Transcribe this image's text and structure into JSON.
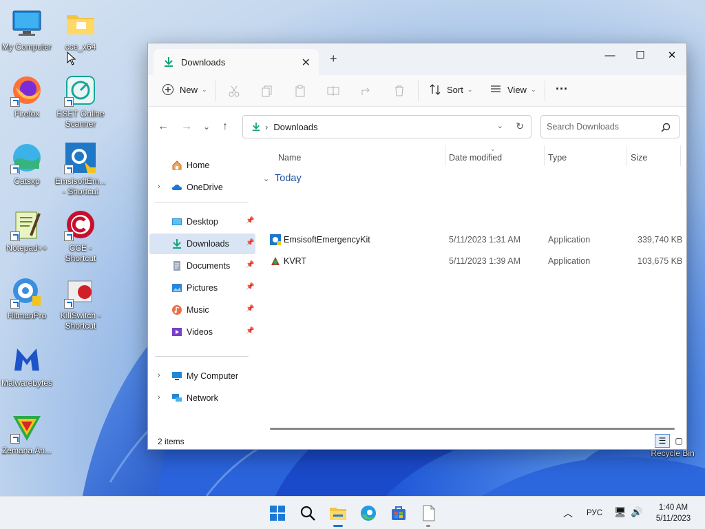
{
  "desktop": {
    "icons": [
      {
        "label": "My Computer",
        "icon": "monitor-icon"
      },
      {
        "label": "cce_x64",
        "icon": "folder-icon"
      },
      {
        "label": "Firefox",
        "icon": "firefox-icon"
      },
      {
        "label": "ESET Online Scanner",
        "icon": "eset-icon"
      },
      {
        "label": "Catsxp",
        "icon": "catsxp-icon"
      },
      {
        "label": "EmsisoftEm... - Shortcut",
        "icon": "emsisoft-icon"
      },
      {
        "label": "Notepad++",
        "icon": "notepadpp-icon"
      },
      {
        "label": "CCE - Shortcut",
        "icon": "comodo-icon"
      },
      {
        "label": "HitmanPro",
        "icon": "hitmanpro-icon"
      },
      {
        "label": "KillSwitch - Shortcut",
        "icon": "killswitch-icon"
      },
      {
        "label": "Malwarebytes",
        "icon": "malwarebytes-icon"
      },
      {
        "label": "Zemana.An...",
        "icon": "zemana-icon"
      },
      {
        "label": "Recycle Bin",
        "icon": "recycle-bin-icon"
      }
    ]
  },
  "window": {
    "tab_title": "Downloads",
    "new_tab_symbol": "+",
    "controls": {
      "minimize": "—",
      "maximize": "☐",
      "close": "✕"
    }
  },
  "toolbar": {
    "new_label": "New",
    "sort_label": "Sort",
    "view_label": "View",
    "more_label": "···"
  },
  "address": {
    "path": "Downloads",
    "search_placeholder": "Search Downloads"
  },
  "sidebar": {
    "home": "Home",
    "onedrive": "OneDrive",
    "quick": [
      "Desktop",
      "Downloads",
      "Documents",
      "Pictures",
      "Music",
      "Videos"
    ],
    "my_computer": "My Computer",
    "network": "Network"
  },
  "filelist": {
    "columns": {
      "name": "Name",
      "date": "Date modified",
      "type": "Type",
      "size": "Size"
    },
    "group": "Today",
    "rows": [
      {
        "name": "EmsisoftEmergencyKit",
        "date": "5/11/2023 1:31 AM",
        "type": "Application",
        "size": "339,740 KB"
      },
      {
        "name": "KVRT",
        "date": "5/11/2023 1:39 AM",
        "type": "Application",
        "size": "103,675 KB"
      }
    ]
  },
  "status": {
    "items": "2 items"
  },
  "taskbar": {
    "lang": "РУС",
    "time": "1:40 AM",
    "date": "5/11/2023"
  }
}
